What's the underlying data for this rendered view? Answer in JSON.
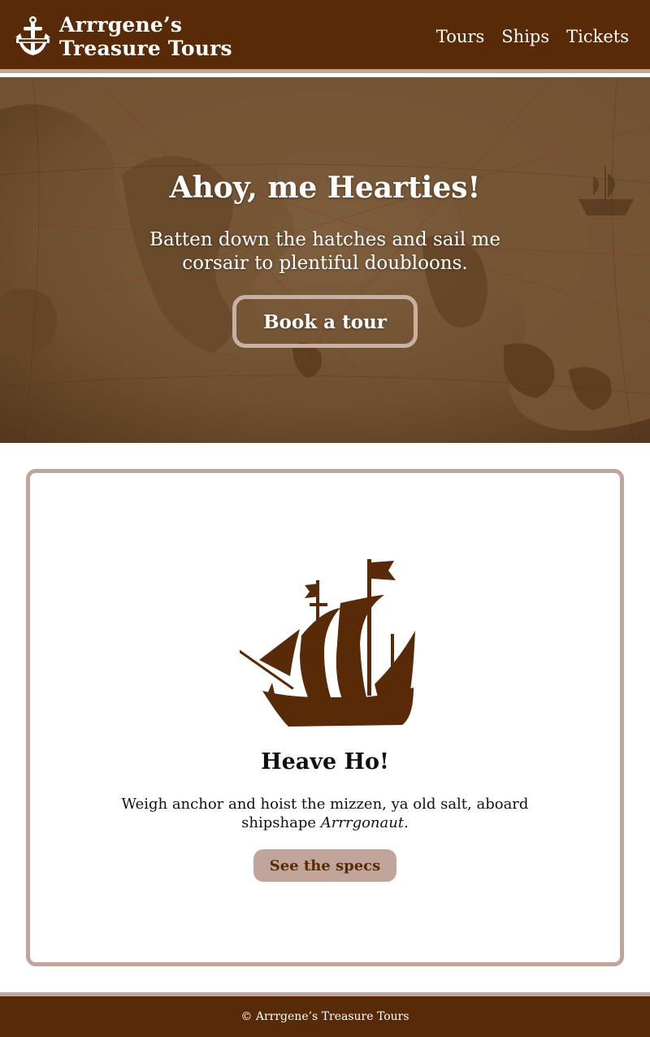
{
  "colors": {
    "brand_brown": "#582a08",
    "accent_tan": "#bfa59a",
    "page_background": "#ffffff"
  },
  "header": {
    "logo_icon": "anchor-icon",
    "brand_line1": "Arrrgene’s",
    "brand_line2": "Treasure Tours",
    "nav": [
      {
        "label": "Tours"
      },
      {
        "label": "Ships"
      },
      {
        "label": "Tickets"
      }
    ]
  },
  "hero": {
    "background": "antique-world-map",
    "title": "Ahoy, me Hearties!",
    "subtitle": "Batten down the hatches and sail me corsair to plentiful doubloons.",
    "button_label": "Book a tour"
  },
  "card": {
    "icon": "galleon-ship-icon",
    "title": "Heave Ho!",
    "text_before": "Weigh anchor and hoist the mizzen, ya old salt, aboard shipshape ",
    "text_emphasis": "Arrrgonaut",
    "text_after": ".",
    "button_label": "See the specs"
  },
  "footer": {
    "copyright": "© Arrrgene’s Treasure Tours"
  }
}
